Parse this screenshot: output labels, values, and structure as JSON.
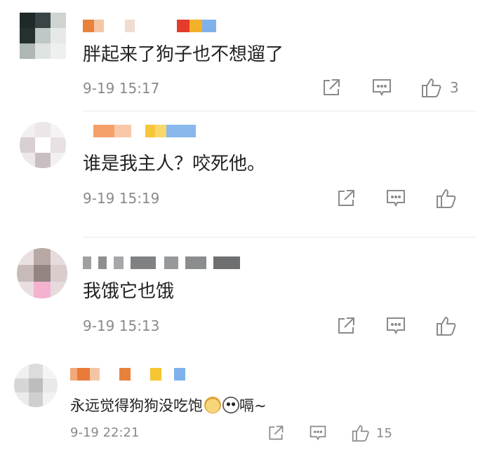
{
  "comments": [
    {
      "text": "胖起来了狗子也不想遛了",
      "time": "9-19 15:17",
      "likes": "3",
      "icons": [
        "share-icon",
        "reply-icon",
        "thumbs-up-icon"
      ]
    },
    {
      "text": "谁是我主人？咬死他。",
      "time": "9-19 15:19",
      "likes": "",
      "icons": [
        "share-icon",
        "reply-icon",
        "thumbs-up-icon"
      ]
    },
    {
      "text": "我饿它也饿",
      "time": "9-19 15:13",
      "likes": "",
      "icons": [
        "share-icon",
        "reply-icon",
        "thumbs-up-icon"
      ]
    },
    {
      "text": "永远觉得狗狗没吃饱",
      "text_suffix": "嗝~",
      "emojis": [
        "dog-face-emoji",
        "panda-face-emoji"
      ],
      "time": "9-19 22:21",
      "likes": "15",
      "icons": [
        "share-icon",
        "reply-icon",
        "thumbs-up-icon"
      ]
    }
  ],
  "colors": {
    "text": "#222222",
    "meta": "#8a8a8a",
    "divider": "#e8e8e8"
  }
}
